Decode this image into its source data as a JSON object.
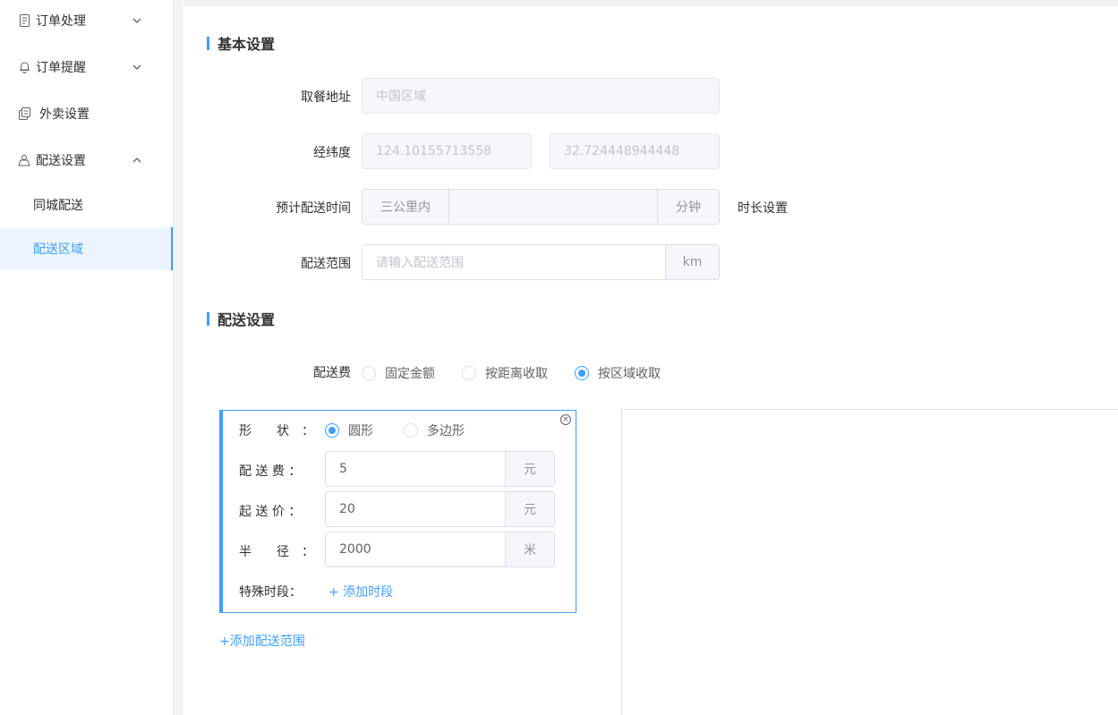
{
  "sidebar": {
    "items": [
      {
        "label": "订单处理",
        "icon": "document-icon",
        "expanded": false
      },
      {
        "label": "订单提醒",
        "icon": "bell-icon",
        "expanded": false
      },
      {
        "label": "外卖设置",
        "icon": "takeout-icon"
      },
      {
        "label": "配送设置",
        "icon": "delivery-icon",
        "expanded": true
      }
    ],
    "subitems": [
      {
        "label": "同城配送",
        "active": false
      },
      {
        "label": "配送区域",
        "active": true
      }
    ]
  },
  "basic": {
    "title": "基本设置",
    "pickup_label": "取餐地址",
    "pickup_value": "中国区域",
    "latlng_label": "经纬度",
    "lng_value": "124.10155713558",
    "lat_value": "32.724448944448",
    "eta_label": "预计配送时间",
    "eta_prepend": "三公里内",
    "eta_value": "",
    "eta_append": "分钟",
    "eta_link": "时长设置",
    "range_label": "配送范围",
    "range_placeholder": "请输入配送范围",
    "range_append": "km"
  },
  "delivery": {
    "title": "配送设置",
    "fee_label": "配送费",
    "fee_options": [
      {
        "label": "固定金额",
        "checked": false
      },
      {
        "label": "按距离收取",
        "checked": false
      },
      {
        "label": "按区域收取",
        "checked": true
      }
    ]
  },
  "area": {
    "shape_label": "形　　状　：",
    "shape_options": [
      {
        "label": "圆形",
        "checked": true
      },
      {
        "label": "多边形",
        "checked": false
      }
    ],
    "fee_label": "配 送 费 ：",
    "fee_value": "5",
    "fee_unit": "元",
    "min_label": "起 送 价 ：",
    "min_value": "20",
    "min_unit": "元",
    "radius_label": "半　　径　：",
    "radius_value": "2000",
    "radius_unit": "米",
    "special_label": "特殊时段：",
    "add_period": "+ 添加时段",
    "add_range": "+添加配送范围"
  }
}
